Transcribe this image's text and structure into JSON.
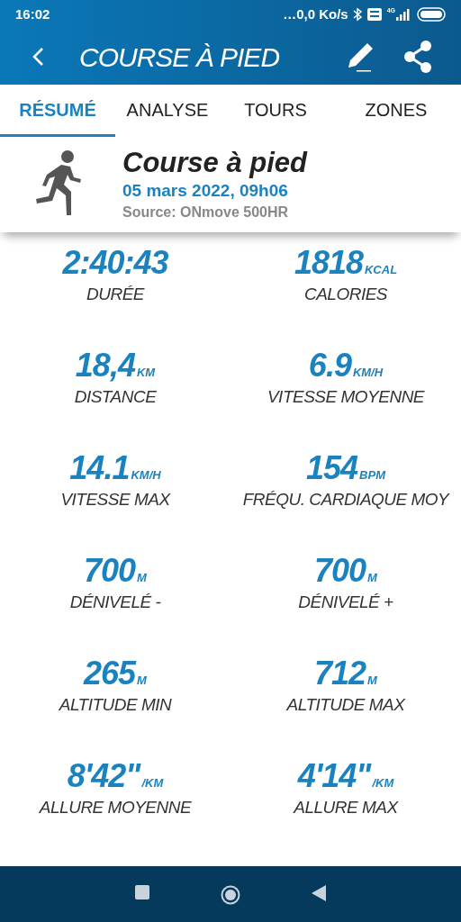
{
  "status_bar": {
    "time": "16:02",
    "network_speed": "…0,0 Ko/s",
    "network_type": "4G"
  },
  "app_bar": {
    "title": "COURSE À PIED"
  },
  "tabs": [
    {
      "label": "RÉSUMÉ",
      "selected": true
    },
    {
      "label": "ANALYSE",
      "selected": false
    },
    {
      "label": "TOURS",
      "selected": false
    },
    {
      "label": "ZONES",
      "selected": false
    }
  ],
  "activity": {
    "name": "Course à pied",
    "date": "05 mars 2022, 09h06",
    "source": "Source: ONmove 500HR"
  },
  "stats": [
    {
      "value": "2:40:43",
      "label": "DURÉE"
    },
    {
      "value": "1818",
      "unit": "KCAL",
      "label": "CALORIES"
    },
    {
      "value": "18,4",
      "unit": "KM",
      "label": "DISTANCE"
    },
    {
      "value": "6.9",
      "unit": "KM/H",
      "label": "VITESSE MOYENNE"
    },
    {
      "value": "14.1",
      "unit": "KM/H",
      "label": "VITESSE MAX"
    },
    {
      "value": "154",
      "unit": "BPM",
      "label": "FRÉQU. CARDIAQUE MOY"
    },
    {
      "value": "700",
      "unit": "M",
      "label": "DÉNIVELÉ -"
    },
    {
      "value": "700",
      "unit": "M",
      "label": "DÉNIVELÉ +"
    },
    {
      "value": "265",
      "unit": "M",
      "label": "ALTITUDE MIN"
    },
    {
      "value": "712",
      "unit": "M",
      "label": "ALTITUDE MAX"
    },
    {
      "value": "8'42\"",
      "unit": "/KM",
      "label": "ALLURE MOYENNE"
    },
    {
      "value": "4'14\"",
      "unit": "/KM",
      "label": "ALLURE MAX"
    }
  ]
}
